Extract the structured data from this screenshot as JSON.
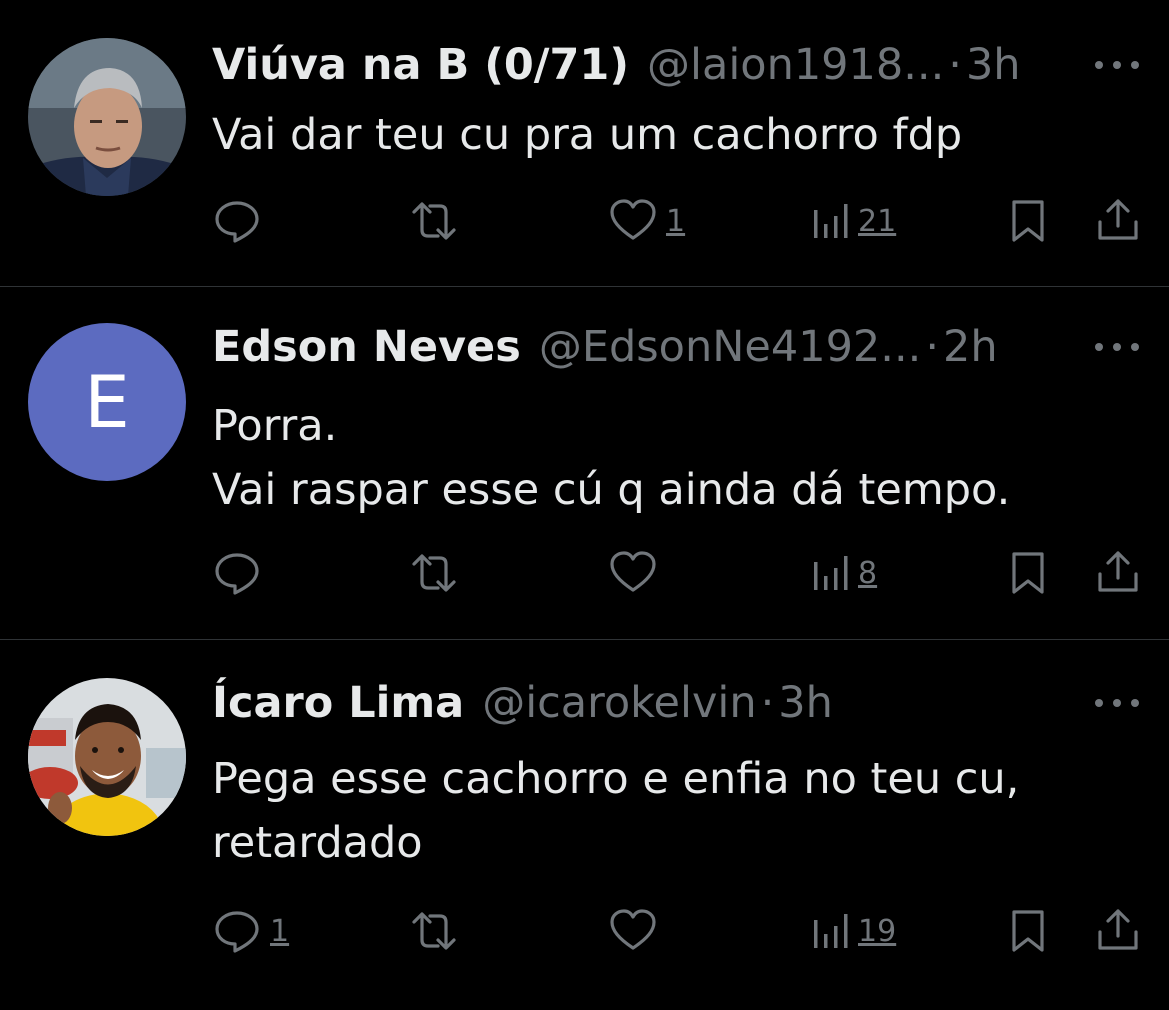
{
  "tweets": [
    {
      "name": "Viúva na B (0/71)",
      "handle": "@laion1918...",
      "dot": "·",
      "time": "3h",
      "text": "Vai dar teu cu pra um cachorro fdp",
      "avatar": "photo-man-gray-hair",
      "counts": {
        "reply": "",
        "retweet": "",
        "like": "1",
        "views": "21"
      }
    },
    {
      "name": "Edson Neves",
      "handle": "@EdsonNe4192...",
      "dot": "·",
      "time": "2h",
      "text": "Porra.\nVai raspar esse cú q ainda dá tempo.",
      "avatar_letter": "E",
      "avatar_color": "#5c6bc0",
      "counts": {
        "reply": "",
        "retweet": "",
        "like": "",
        "views": "8"
      }
    },
    {
      "name": "Ícaro Lima",
      "handle": "@icarokelvin",
      "dot": "·",
      "time": "3h",
      "text": "Pega esse cachorro e enfia no teu cu,\nretardado",
      "avatar": "photo-smiling-man-yellow-shirt",
      "counts": {
        "reply": "1",
        "retweet": "",
        "like": "",
        "views": "19"
      }
    }
  ],
  "colors": {
    "background": "#000000",
    "text": "#e7e9ea",
    "secondary": "#71767b",
    "divider": "#2f3336"
  },
  "icons": [
    "reply-icon",
    "retweet-icon",
    "like-icon",
    "views-icon",
    "bookmark-icon",
    "share-icon",
    "more-icon"
  ]
}
